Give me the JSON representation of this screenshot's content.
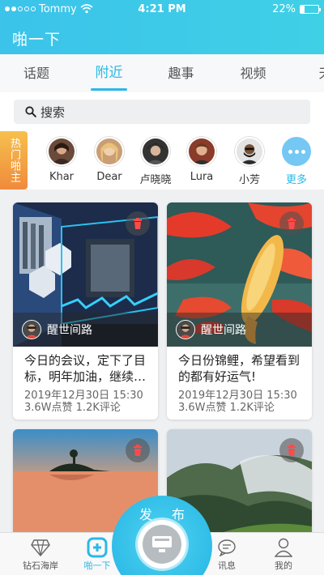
{
  "status_bar": {
    "carrier": "Tommy",
    "time": "4:21 PM",
    "battery": "22%",
    "battery_level": 0.22
  },
  "app": {
    "title": "啪一下"
  },
  "tabs": [
    {
      "label": "话题"
    },
    {
      "label": "附近",
      "active": true
    },
    {
      "label": "趣事"
    },
    {
      "label": "视频"
    },
    {
      "label": "天"
    }
  ],
  "search": {
    "placeholder": "搜索"
  },
  "hot_badge": {
    "label": "热门啪主"
  },
  "users": [
    {
      "name": "Khar"
    },
    {
      "name": "Dear"
    },
    {
      "name": "卢晓晓"
    },
    {
      "name": "Lura"
    },
    {
      "name": "小芳"
    }
  ],
  "more": {
    "label": "更多"
  },
  "cards": [
    {
      "author": "醒世间路",
      "desc": "今日的会议，定下了目标，明年加油，继续…",
      "date": "2019年12月30日  15:30",
      "stats": "3.6W点赞  1.2K评论"
    },
    {
      "author": "醒世间路",
      "desc": "今日份锦鲤，希望看到的都有好运气!",
      "date": "2019年12月30日  15:30",
      "stats": "3.6W点赞  1.2K评论"
    },
    {
      "author": "",
      "desc": "",
      "date": "",
      "stats": ""
    },
    {
      "author": "",
      "desc": "",
      "date": "",
      "stats": ""
    }
  ],
  "publish": {
    "char1": "发",
    "char2": "布"
  },
  "bottom_nav": [
    {
      "label": "钻石海岸",
      "icon": "diamond-icon"
    },
    {
      "label": "啪一下",
      "icon": "app-logo-icon",
      "active": true
    },
    {
      "label": "",
      "icon": "publish-icon"
    },
    {
      "label": "讯息",
      "icon": "message-icon"
    },
    {
      "label": "我的",
      "icon": "profile-icon"
    }
  ],
  "colors": {
    "accent": "#2bb8e8",
    "header": "#3bc3ea"
  }
}
